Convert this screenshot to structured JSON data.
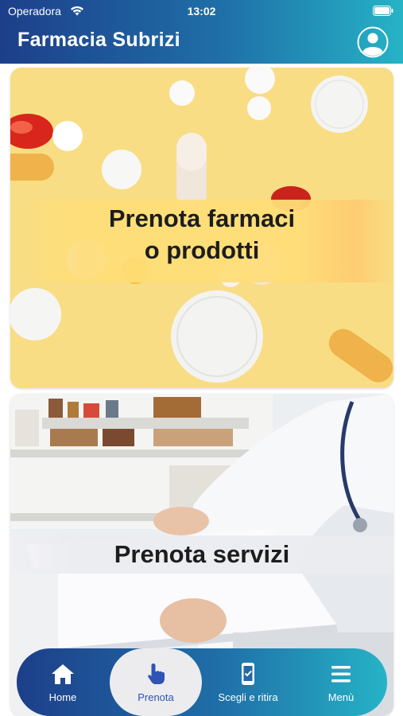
{
  "status_bar": {
    "carrier": "Operadora",
    "time": "13:02"
  },
  "header": {
    "title": "Farmacia Subrizi",
    "profile_icon": "user-circle-icon"
  },
  "cards": {
    "meds": {
      "line1": "Prenota farmaci",
      "line2": "o prodotti"
    },
    "services": {
      "label": "Prenota servizi"
    }
  },
  "tabbar": {
    "items": [
      {
        "label": "Home",
        "icon": "home-icon"
      },
      {
        "label": "Prenota",
        "icon": "pointing-hand-icon",
        "active": true
      },
      {
        "label": "Scegli e ritira",
        "icon": "phone-check-icon"
      },
      {
        "label": "Menù",
        "icon": "hamburger-menu-icon"
      }
    ]
  },
  "colors": {
    "header_start": "#1d3f8a",
    "header_end": "#26b3c6",
    "active_tab": "#2f54b5"
  }
}
